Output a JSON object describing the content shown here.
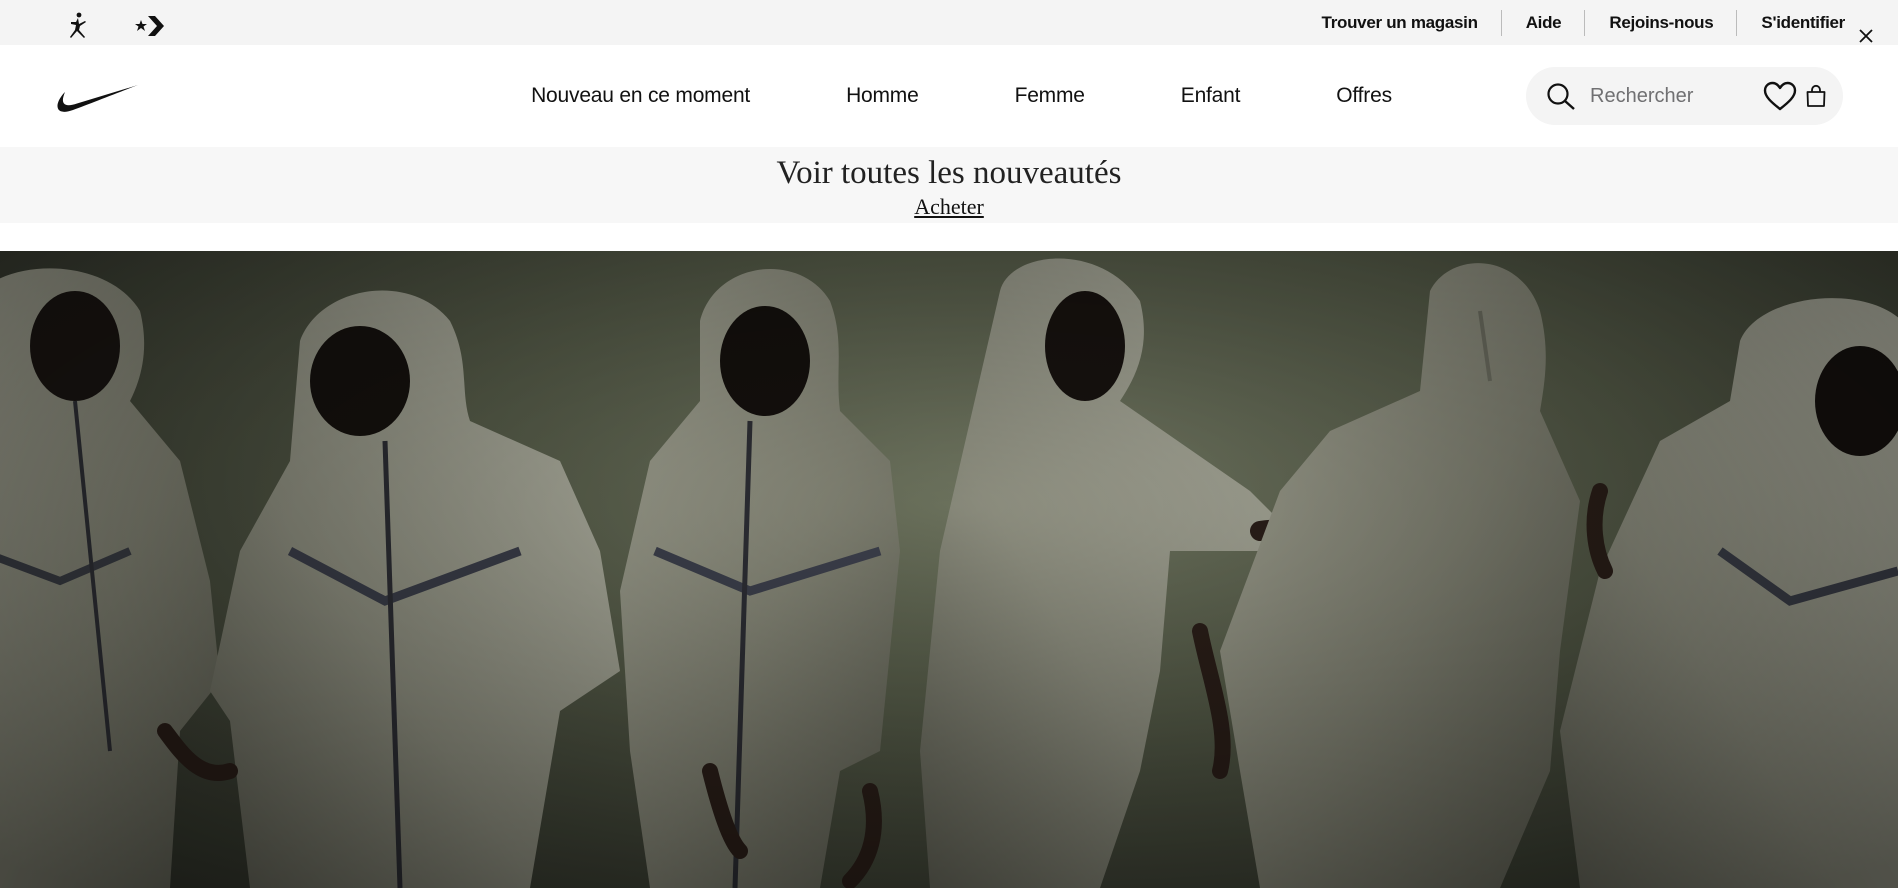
{
  "utility_bar": {
    "brands": [
      {
        "name": "jordan",
        "icon": "jordan-jumpman-icon"
      },
      {
        "name": "converse",
        "icon": "converse-star-chevron-icon"
      }
    ],
    "links": [
      {
        "label": "Trouver un magasin"
      },
      {
        "label": "Aide"
      },
      {
        "label": "Rejoins-nous"
      },
      {
        "label": "S'identifier"
      }
    ],
    "close_icon": "close-icon"
  },
  "header": {
    "logo_icon": "nike-swoosh-icon",
    "nav": [
      {
        "label": "Nouveau en ce moment"
      },
      {
        "label": "Homme"
      },
      {
        "label": "Femme"
      },
      {
        "label": "Enfant"
      },
      {
        "label": "Offres"
      }
    ],
    "search": {
      "placeholder": "Rechercher",
      "value": "",
      "icon": "search-icon"
    },
    "favorites_icon": "heart-icon",
    "bag_icon": "shopping-bag-icon"
  },
  "promo": {
    "title": "Voir toutes les nouveautés",
    "link_label": "Acheter"
  },
  "hero": {
    "image_alt": "",
    "colors": {
      "background": "#555b48",
      "jacket": "#8a8b7c",
      "skin": "#2a1e18"
    }
  },
  "colors": {
    "utility_bg": "#f4f4f4",
    "text": "#111111",
    "promo_bg": "#f7f7f7"
  }
}
